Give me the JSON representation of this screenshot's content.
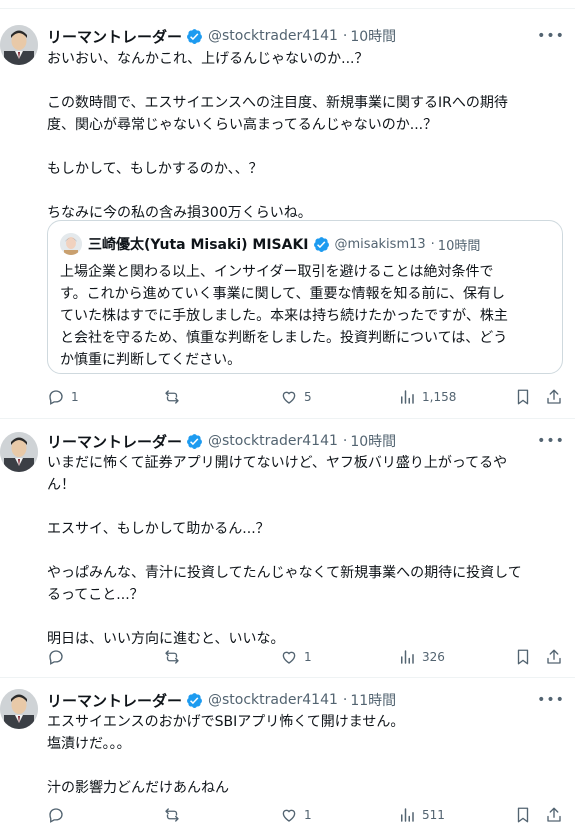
{
  "tweets": [
    {
      "name": "リーマントレーダー",
      "handle": "@stocktrader4141",
      "time": "10時間",
      "lines": [
        "おいおい、なんかこれ、上げるんじゃないのか...？",
        "",
        "この数時間で、エスサイエンスへの注目度、新規事業に関するIRへの期待",
        "度、関心が尋常じゃないくらい高まってるんじゃないのか...？",
        "",
        "もしかして、もしかするのか、、？",
        "",
        "ちなみに今の私の含み損300万くらいね。"
      ],
      "quote": {
        "name": "三崎優太(Yuta Misaki) MISAKI",
        "handle": "@misakism13",
        "time": "10時間",
        "lines": [
          "上場企業と関わる以上、インサイダー取引を避けることは絶対条件で",
          "す。これから進めていく事業に関して、重要な情報を知る前に、保有し",
          "ていた株はすでに手放しました。本来は持ち続けたかったですが、株主",
          "と会社を守るため、慎重な判断をしました。投資判断については、どう",
          "か慎重に判断してください。"
        ]
      },
      "replies": "1",
      "retweets": "",
      "likes": "5",
      "views": "1,158"
    },
    {
      "name": "リーマントレーダー",
      "handle": "@stocktrader4141",
      "time": "10時間",
      "lines": [
        "いまだに怖くて証券アプリ開けてないけど、ヤフ板バリ盛り上がってるや",
        "ん！",
        "",
        "エスサイ、もしかして助かるん...？",
        "",
        "やっぱみんな、青汁に投資してたんじゃなくて新規事業への期待に投資して",
        "るってこと...？",
        "",
        "明日は、いい方向に進むと、いいな。"
      ],
      "replies": "",
      "retweets": "",
      "likes": "1",
      "views": "326"
    },
    {
      "name": "リーマントレーダー",
      "handle": "@stocktrader4141",
      "time": "11時間",
      "lines": [
        "エスサイエンスのおかげでSBIアプリ怖くて開けません。",
        "塩漬けだ。。。",
        "",
        "汁の影響力どんだけあんねん"
      ],
      "replies": "",
      "retweets": "",
      "likes": "1",
      "views": "511"
    }
  ]
}
